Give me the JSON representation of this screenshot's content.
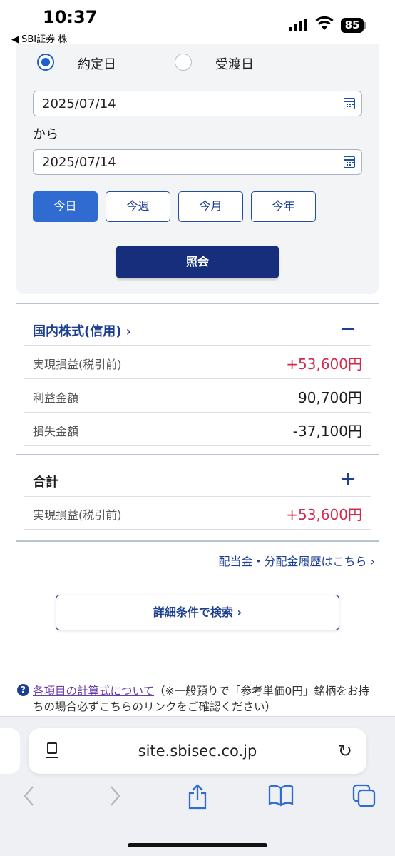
{
  "status_bar": {
    "time": "10:37",
    "back_app": "◀ SBI証券 株",
    "battery": "85"
  },
  "form": {
    "radio_trade_date": "約定日",
    "radio_settle_date": "受渡日",
    "selected_radio": "約定日",
    "date_from": "2025/07/14",
    "from_label": "から",
    "date_to": "2025/07/14",
    "period_buttons": [
      "今日",
      "今週",
      "今月",
      "今年"
    ],
    "active_period": "今日",
    "submit_label": "照会"
  },
  "domestic_section": {
    "title": "国内株式(信用) ›",
    "rows": [
      {
        "label": "実現損益(税引前)",
        "value": "+53,600円"
      },
      {
        "label": "利益金額",
        "value": "90,700円"
      },
      {
        "label": "損失金額",
        "value": "-37,100円"
      }
    ]
  },
  "total_section": {
    "title": "合計",
    "rows": [
      {
        "label": "実現損益(税引前)",
        "value": "+53,600円"
      }
    ]
  },
  "dividend_link": "配当金・分配金履歴はこちら ›",
  "detail_search_label": "詳細条件で検索 ›",
  "help_note": {
    "link_text": "各項目の計算式について",
    "text": "（※一般預りで「参考単価0円」銘柄をお持ちの場合必ずこちらのリンクをご確認ください）"
  },
  "browser": {
    "url": "site.sbisec.co.jp"
  },
  "colors": {
    "accent": "#1d3f8f",
    "positive": "#d3294d",
    "primary_button": "#162e7c",
    "active_chip": "#2f6bd1"
  }
}
